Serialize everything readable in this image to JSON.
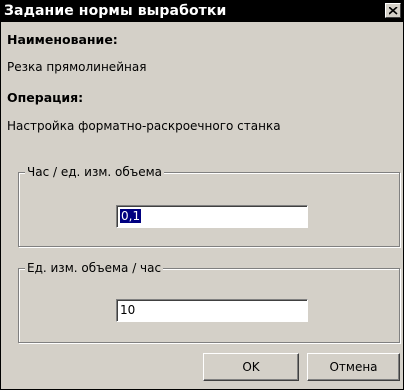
{
  "dialog": {
    "title": "Задание нормы выработки",
    "close_icon": "close-icon"
  },
  "info": {
    "name_label": "Наименование:",
    "name_value": "Резка прямолинейная",
    "operation_label": "Операция:",
    "operation_value": "Настройка форматно-раскроечного станка"
  },
  "group_hours_per_unit": {
    "legend": "Час / ед. изм. объема",
    "value": "0,1"
  },
  "group_units_per_hour": {
    "legend": "Ед. изм. объема / час",
    "value": "10"
  },
  "buttons": {
    "ok_label": "OK",
    "cancel_label": "Отмена"
  },
  "colors": {
    "titlebar_background": "#000000",
    "titlebar_text": "#ffffff",
    "dialog_background": "#d4d0c8",
    "selection_highlight": "#000080"
  }
}
